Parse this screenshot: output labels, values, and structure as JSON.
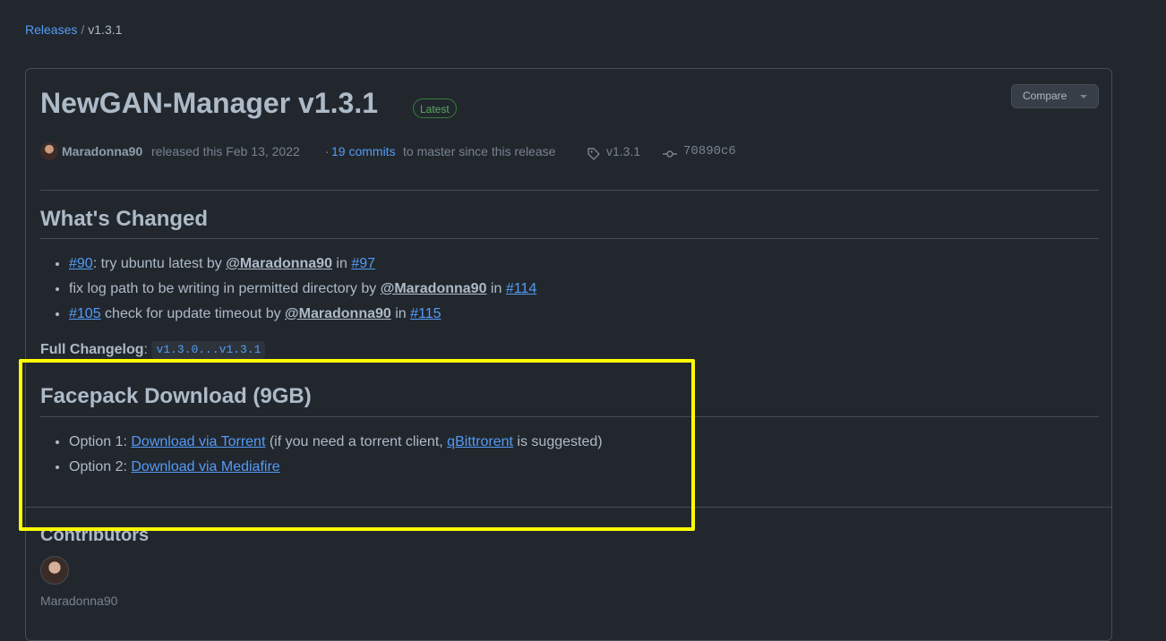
{
  "breadcrumb": {
    "root": "Releases",
    "separator": "/",
    "current": "v1.3.1"
  },
  "release": {
    "title": "NewGAN-Manager v1.3.1",
    "badge": "Latest",
    "compare_label": "Compare",
    "author": "Maradonna90",
    "released_text": "released this Feb 13, 2022",
    "dot": "·",
    "commits_link": "19 commits",
    "since_text": "to master since this release",
    "tag": "v1.3.1",
    "sha": "70890c6"
  },
  "whats_changed": {
    "heading": "What's Changed",
    "items": [
      {
        "link1": "#90",
        "text1": ": try ubuntu latest by ",
        "user": "@Maradonna90",
        "text2": " in ",
        "link2": "#97"
      },
      {
        "link1": "",
        "text1": "fix log path to be writing in permitted directory by ",
        "user": "@Maradonna90",
        "text2": " in ",
        "link2": "#114"
      },
      {
        "link1": "#105",
        "text1": " check for update timeout by ",
        "user": "@Maradonna90",
        "text2": " in ",
        "link2": "#115"
      }
    ]
  },
  "changelog": {
    "label": "Full Changelog",
    "colon": ": ",
    "value": "v1.3.0...v1.3.1"
  },
  "facepack": {
    "heading": "Facepack Download (9GB)",
    "option1": {
      "prefix": "Option 1: ",
      "link": "Download via Torrent",
      "middle": " (if you need a torrent client, ",
      "link2": "qBittrorent",
      "suffix": " is suggested)"
    },
    "option2": {
      "prefix": "Option 2: ",
      "link": "Download via Mediafire"
    }
  },
  "contributors": {
    "heading": "Contributors",
    "name": "Maradonna90"
  },
  "colors": {
    "background": "#22272e",
    "link": "#539bf5",
    "highlight": "#ffff00",
    "badge": "#57ab5a"
  }
}
